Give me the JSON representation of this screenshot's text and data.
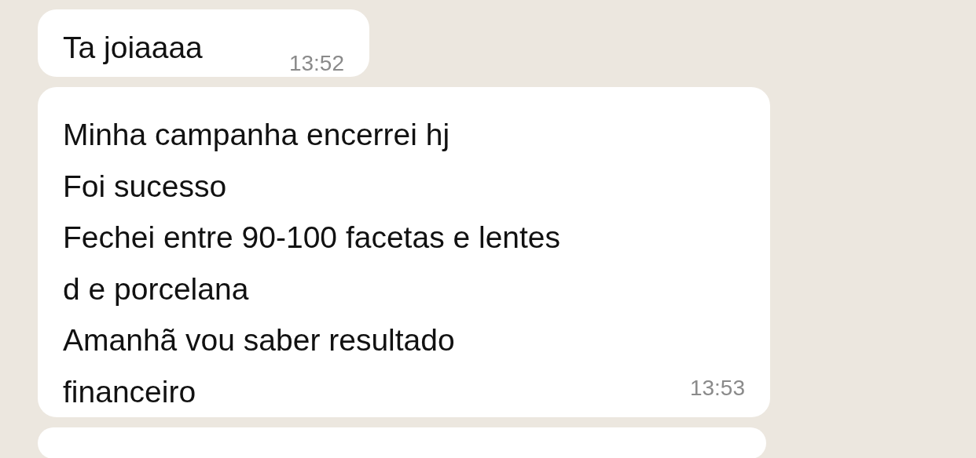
{
  "messages": [
    {
      "lines": [
        "Ta joiaaaa"
      ],
      "time": "13:52"
    },
    {
      "lines": [
        "Minha campanha encerrei hj",
        "Foi sucesso",
        "Fechei entre 90-100 facetas e lentes",
        "d e porcelana",
        "Amanhã vou saber resultado",
        "financeiro"
      ],
      "time": "13:53"
    }
  ]
}
